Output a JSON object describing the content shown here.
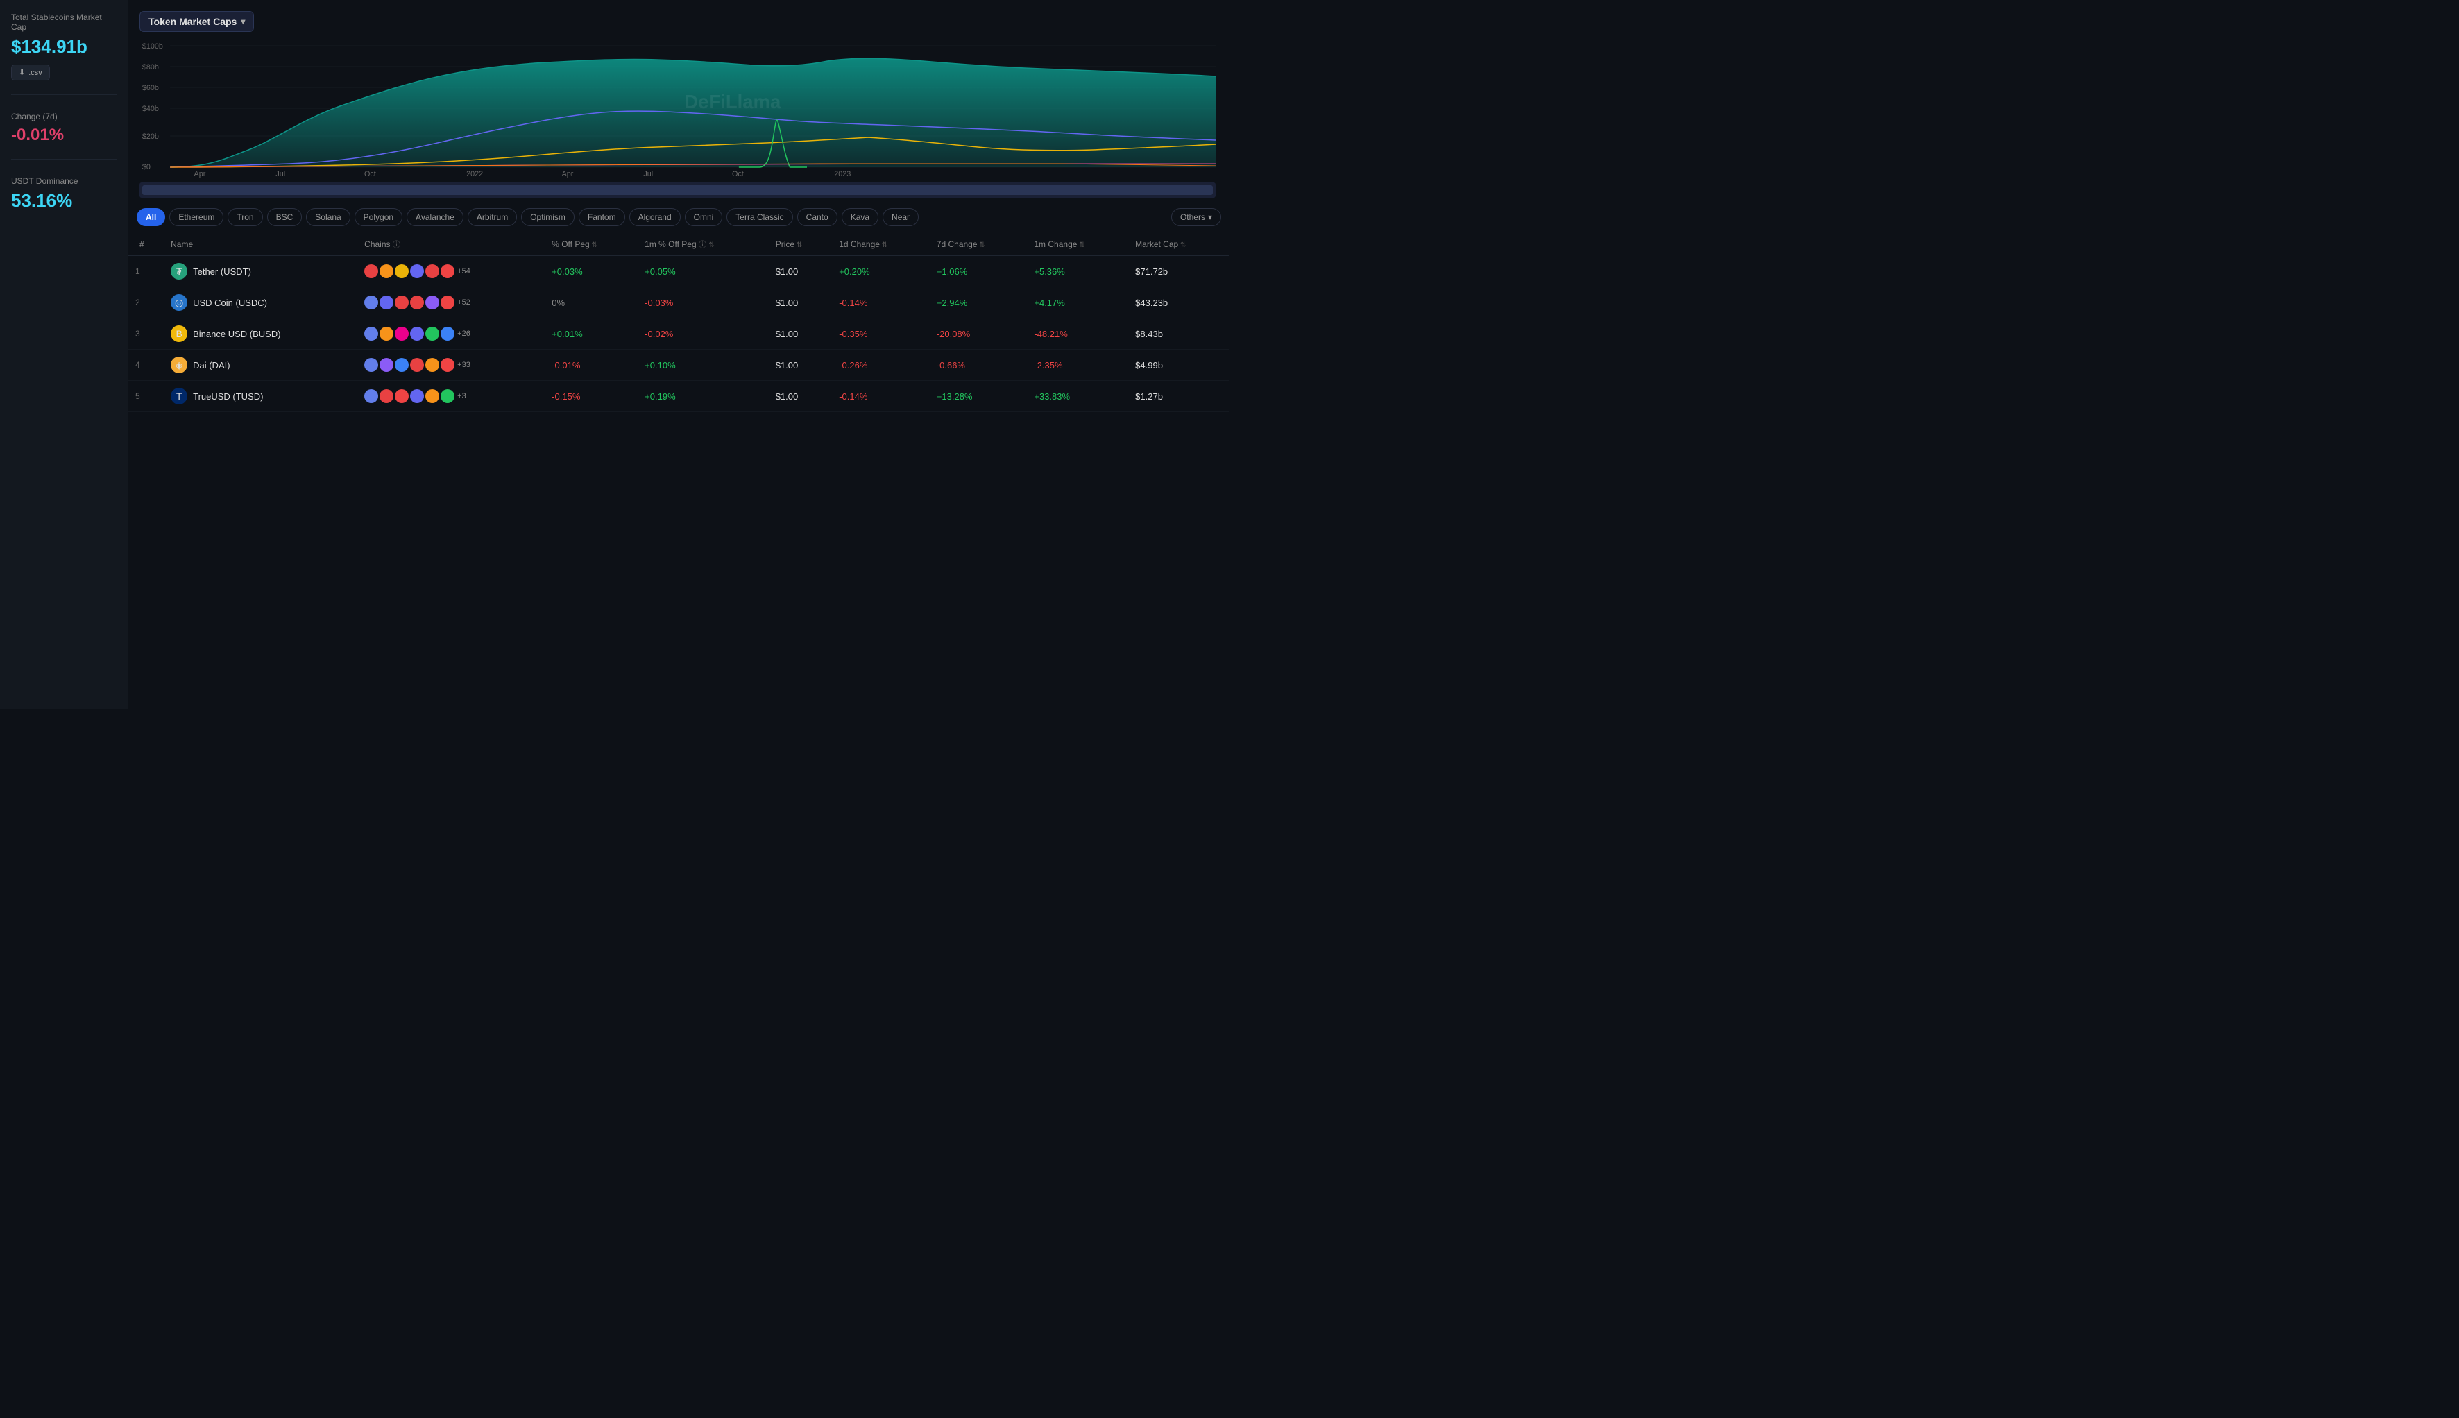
{
  "left_panel": {
    "total_market_cap": {
      "label": "Total Stablecoins Market Cap",
      "value": "$134.91b",
      "csv_label": ".csv"
    },
    "change_7d": {
      "label": "Change (7d)",
      "value": "-0.01%"
    },
    "usdt_dominance": {
      "label": "USDT Dominance",
      "value": "53.16%"
    }
  },
  "chart": {
    "title": "Token Market Caps",
    "y_labels": [
      "$100b",
      "$80b",
      "$60b",
      "$40b",
      "$20b",
      "$0"
    ],
    "x_labels": [
      "Apr",
      "Jul",
      "Oct",
      "2022",
      "Apr",
      "Jul",
      "Oct",
      "2023"
    ],
    "watermark": "DeFiLlama"
  },
  "filter_tabs": {
    "tabs": [
      {
        "label": "All",
        "active": true
      },
      {
        "label": "Ethereum",
        "active": false
      },
      {
        "label": "Tron",
        "active": false
      },
      {
        "label": "BSC",
        "active": false
      },
      {
        "label": "Solana",
        "active": false
      },
      {
        "label": "Polygon",
        "active": false
      },
      {
        "label": "Avalanche",
        "active": false
      },
      {
        "label": "Arbitrum",
        "active": false
      },
      {
        "label": "Optimism",
        "active": false
      },
      {
        "label": "Fantom",
        "active": false
      },
      {
        "label": "Algorand",
        "active": false
      },
      {
        "label": "Omni",
        "active": false
      },
      {
        "label": "Terra Classic",
        "active": false
      },
      {
        "label": "Canto",
        "active": false
      },
      {
        "label": "Kava",
        "active": false
      },
      {
        "label": "Near",
        "active": false
      }
    ],
    "others_label": "Others"
  },
  "table": {
    "columns": [
      "#",
      "Name",
      "Chains",
      "% Off Peg",
      "1m % Off Peg",
      "Price",
      "1d Change",
      "7d Change",
      "1m Change",
      "Market Cap"
    ],
    "rows": [
      {
        "rank": "1",
        "name": "Tether (USDT)",
        "icon": "₮",
        "icon_color": "#26a17b",
        "chains_extra": "+54",
        "off_peg": "+0.03%",
        "off_peg_class": "green",
        "off_peg_1m": "+0.05%",
        "off_peg_1m_class": "green",
        "price": "$1.00",
        "change_1d": "+0.20%",
        "change_1d_class": "green",
        "change_7d": "+1.06%",
        "change_7d_class": "green",
        "change_1m": "+5.36%",
        "change_1m_class": "green",
        "market_cap": "$71.72b"
      },
      {
        "rank": "2",
        "name": "USD Coin (USDC)",
        "icon": "◎",
        "icon_color": "#2775ca",
        "chains_extra": "+52",
        "off_peg": "0%",
        "off_peg_class": "neutral",
        "off_peg_1m": "-0.03%",
        "off_peg_1m_class": "red",
        "price": "$1.00",
        "change_1d": "-0.14%",
        "change_1d_class": "red",
        "change_7d": "+2.94%",
        "change_7d_class": "green",
        "change_1m": "+4.17%",
        "change_1m_class": "green",
        "market_cap": "$43.23b"
      },
      {
        "rank": "3",
        "name": "Binance USD (BUSD)",
        "icon": "B",
        "icon_color": "#f0b90b",
        "chains_extra": "+26",
        "off_peg": "+0.01%",
        "off_peg_class": "green",
        "off_peg_1m": "-0.02%",
        "off_peg_1m_class": "red",
        "price": "$1.00",
        "change_1d": "-0.35%",
        "change_1d_class": "red",
        "change_7d": "-20.08%",
        "change_7d_class": "red",
        "change_1m": "-48.21%",
        "change_1m_class": "red",
        "market_cap": "$8.43b"
      },
      {
        "rank": "4",
        "name": "Dai (DAI)",
        "icon": "◈",
        "icon_color": "#f5ac37",
        "chains_extra": "+33",
        "off_peg": "-0.01%",
        "off_peg_class": "red",
        "off_peg_1m": "+0.10%",
        "off_peg_1m_class": "green",
        "price": "$1.00",
        "change_1d": "-0.26%",
        "change_1d_class": "red",
        "change_7d": "-0.66%",
        "change_7d_class": "red",
        "change_1m": "-2.35%",
        "change_1m_class": "red",
        "market_cap": "$4.99b"
      },
      {
        "rank": "5",
        "name": "TrueUSD (TUSD)",
        "icon": "T",
        "icon_color": "#002868",
        "chains_extra": "+3",
        "off_peg": "-0.15%",
        "off_peg_class": "red",
        "off_peg_1m": "+0.19%",
        "off_peg_1m_class": "green",
        "price": "$1.00",
        "change_1d": "-0.14%",
        "change_1d_class": "red",
        "change_7d": "+13.28%",
        "change_7d_class": "green",
        "change_1m": "+33.83%",
        "change_1m_class": "green",
        "market_cap": "$1.27b"
      }
    ]
  }
}
